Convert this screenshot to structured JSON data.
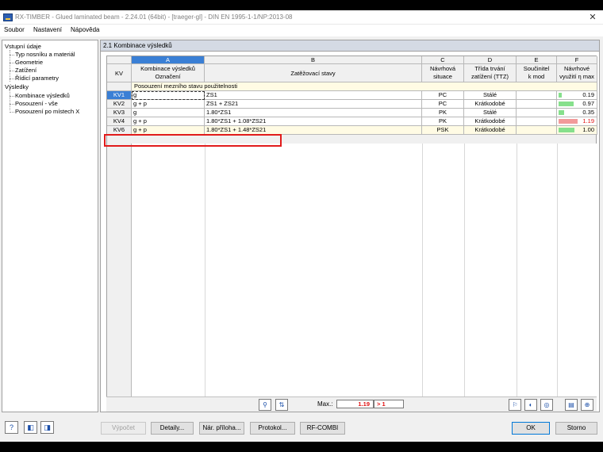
{
  "window": {
    "title": "RX-TIMBER - Glued laminated beam - 2.24.01 (64bit) - [traeger-gl] - DIN EN 1995-1-1/NP:2013-08"
  },
  "menu": [
    "Soubor",
    "Nastavení",
    "Nápověda"
  ],
  "nav": {
    "input_root": "Vstupní údaje",
    "input_items": [
      "Typ nosníku a materiál",
      "Geometrie",
      "Zatížení",
      "Řídicí parametry"
    ],
    "results_root": "Výsledky",
    "results_items": [
      "Kombinace výsledků",
      "Posouzení - vše",
      "Posouzení po místech X"
    ]
  },
  "panel": {
    "title": "2.1 Kombinace výsledků"
  },
  "table": {
    "col_letters": [
      "A",
      "B",
      "C",
      "D",
      "E",
      "F"
    ],
    "kv_header": "KV",
    "headers": {
      "a1": "Kombinace výsledků",
      "a2": "Označení",
      "b1": "Zatěžovací stavy",
      "c1": "Návrhová",
      "c2": "situace",
      "d1": "Třída trvání",
      "d2": "zatížení (TTZ)",
      "e1": "Součinitel",
      "e2": "k mod",
      "f1": "Návrhové",
      "f2": "využití η max"
    },
    "group_label": "Posouzení mezního stavu použitelnosti",
    "rows": [
      {
        "kv": "KV1",
        "name": "g",
        "loads": "ZS1",
        "situation": "PC",
        "duration": "Stálé",
        "util": "0.19",
        "util_num": 0.19
      },
      {
        "kv": "KV2",
        "name": "g + p",
        "loads": "ZS1 + ZS21",
        "situation": "PC",
        "duration": "Krátkodobé",
        "util": "0.97",
        "util_num": 0.97
      },
      {
        "kv": "KV3",
        "name": "g",
        "loads": "1.80*ZS1",
        "situation": "PK",
        "duration": "Stálé",
        "util": "0.35",
        "util_num": 0.35
      },
      {
        "kv": "KV4",
        "name": "g + p",
        "loads": "1.80*ZS1 + 1.08*ZS21",
        "situation": "PK",
        "duration": "Krátkodobé",
        "util": "1.19",
        "util_num": 1.19
      },
      {
        "kv": "KV6",
        "name": "g + p",
        "loads": "1.80*ZS1 + 1.48*ZS21",
        "situation": "PSK",
        "duration": "Krátkodobé",
        "util": "1.00",
        "util_num": 1.0
      }
    ]
  },
  "toolbar": {
    "max_label": "Max.:",
    "max_value": "1.19",
    "max_flag": "> 1"
  },
  "footer": {
    "calc": "Výpočet",
    "details": "Detaily...",
    "annex": "Nár. příloha...",
    "protocol": "Protokol...",
    "rfcombi": "RF-COMBI",
    "ok": "OK",
    "cancel": "Storno"
  },
  "colors": {
    "accent": "#3a7fd5",
    "bar_ok": "#86e08c",
    "bar_fail": "#f29a9a",
    "highlight": "#e11b1b"
  }
}
